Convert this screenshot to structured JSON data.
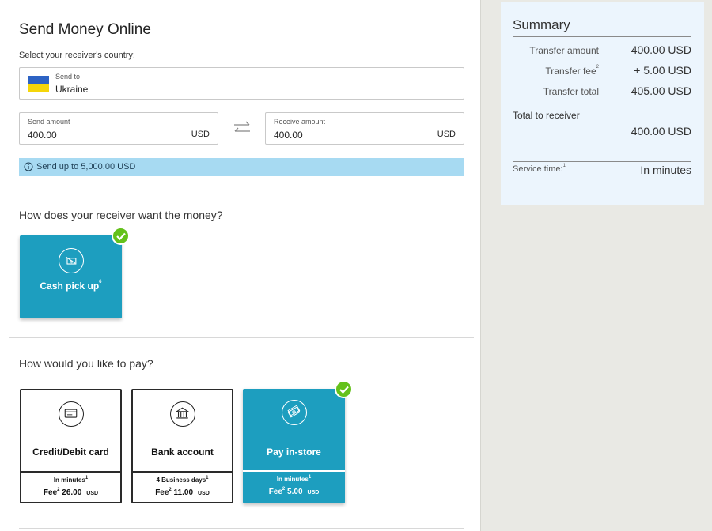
{
  "page_title": "Send Money Online",
  "country": {
    "prompt": "Select your receiver's country:",
    "label": "Send to",
    "value": "Ukraine"
  },
  "send": {
    "label": "Send amount",
    "value": "400.00",
    "currency": "USD"
  },
  "receive": {
    "label": "Receive amount",
    "value": "400.00",
    "currency": "USD"
  },
  "info_bar": {
    "text": "Send up to 5,000.00 USD"
  },
  "receive_method": {
    "title": "How does your receiver want the money?",
    "options": [
      {
        "label": "Cash pick up",
        "sup": "6",
        "icon": "cash-pickup-icon",
        "selected": true
      }
    ]
  },
  "payment": {
    "title": "How would you like to pay?",
    "options": [
      {
        "label": "Credit/Debit card",
        "time": "In minutes",
        "time_sup": "1",
        "fee_label": "Fee",
        "fee_sup": "2",
        "fee": "26.00",
        "currency": "USD",
        "icon": "credit-card-icon",
        "selected": false
      },
      {
        "label": "Bank account",
        "time": "4  Business days",
        "time_sup": "1",
        "fee_label": "Fee",
        "fee_sup": "2",
        "fee": "11.00",
        "currency": "USD",
        "icon": "bank-icon",
        "selected": false
      },
      {
        "label": "Pay in-store",
        "time": "In minutes",
        "time_sup": "1",
        "fee_label": "Fee",
        "fee_sup": "2",
        "fee": "5.00",
        "currency": "USD",
        "icon": "cash-stack-icon",
        "selected": true
      }
    ]
  },
  "summary": {
    "title": "Summary",
    "rows": [
      {
        "label": "Transfer amount",
        "sup": "",
        "value": "400.00  USD"
      },
      {
        "label": "Transfer fee",
        "sup": "2",
        "value": "+ 5.00  USD"
      },
      {
        "label": "Transfer total",
        "sup": "",
        "value": "405.00  USD"
      }
    ],
    "total_to_receiver_label": "Total to receiver",
    "total_to_receiver_value": "400.00  USD",
    "service_time_label": "Service time:",
    "service_time_sup": "1",
    "service_time_value": "In minutes"
  },
  "colors": {
    "accent": "#1d9ebf",
    "check": "#64c11b",
    "info_bar": "#a7daf2",
    "summary_bg": "#ecf5fd"
  }
}
